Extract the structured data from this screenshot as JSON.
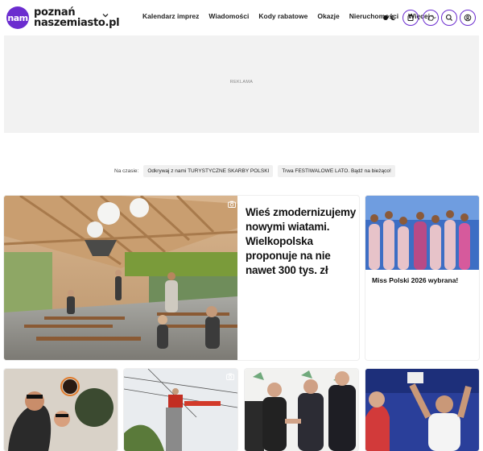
{
  "header": {
    "logo_badge": "nam",
    "logo_line1": "poznań",
    "logo_line2": "naszemiasto.pl",
    "nav": [
      {
        "label": "Kalendarz imprez"
      },
      {
        "label": "Wiadomości"
      },
      {
        "label": "Kody rabatowe"
      },
      {
        "label": "Okazje"
      },
      {
        "label": "Nieruchomości"
      },
      {
        "label": "Więcej"
      }
    ],
    "icons": [
      "newspaper-icon",
      "hand-icon",
      "search-icon",
      "user-icon"
    ],
    "accent": "#6b2ccf"
  },
  "ad": {
    "label": "REKLAMA"
  },
  "trending": {
    "label": "Na czasie:",
    "chips": [
      "Odkrywaj z nami TURYSTYCZNE SKARBY POLSKI",
      "Trwa FESTIWALOWE LATO. Bądź na bieżąco!"
    ]
  },
  "featured": {
    "title": "Wieś zmodernizujemy nowymi wiatami. Wielkopolska proponuje na nie nawet 300 tys. zł"
  },
  "side_card": {
    "title": "Miss Polski 2026 wybrana!"
  },
  "bottom_cards": [
    {
      "title": ""
    },
    {
      "title": ""
    },
    {
      "title": ""
    },
    {
      "title": ""
    }
  ]
}
